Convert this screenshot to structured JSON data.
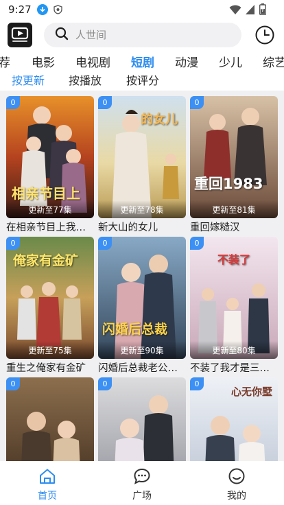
{
  "status": {
    "time": "9:27",
    "icons": [
      "download-icon",
      "shield-icon",
      "wifi-icon",
      "signal-icon",
      "battery-icon"
    ]
  },
  "header": {
    "logo_icon": "play-logo-icon",
    "search_placeholder": "人世间",
    "search_icon": "search-icon",
    "history_icon": "clock-icon"
  },
  "categories": {
    "items": [
      "荐",
      "电影",
      "电视剧",
      "短剧",
      "动漫",
      "少儿",
      "综艺"
    ],
    "active": "短剧"
  },
  "sort": {
    "items": [
      "按更新",
      "按播放",
      "按评分"
    ],
    "active": "按更新"
  },
  "accent_color": "#2c8cf0",
  "cards": [
    {
      "badge": "0",
      "episodes": "更新至77集",
      "title": "在相亲节目上我…",
      "poster_text": "相亲节目上"
    },
    {
      "badge": "0",
      "episodes": "更新至78集",
      "title": "新大山的女儿",
      "poster_text": "的女儿"
    },
    {
      "badge": "0",
      "episodes": "更新至81集",
      "title": "重回嫁糙汉",
      "poster_text": "重回1983"
    },
    {
      "badge": "0",
      "episodes": "更新至75集",
      "title": "重生之俺家有金矿",
      "poster_text": "俺家有金矿"
    },
    {
      "badge": "0",
      "episodes": "更新至90集",
      "title": "闪婚后总裁老公…",
      "poster_text": "闪婚后总裁"
    },
    {
      "badge": "0",
      "episodes": "更新至80集",
      "title": "不装了我才是三…",
      "poster_text": "不装了"
    },
    {
      "badge": "0",
      "episodes": "",
      "title": "",
      "poster_text": ""
    },
    {
      "badge": "0",
      "episodes": "",
      "title": "",
      "poster_text": ""
    },
    {
      "badge": "0",
      "episodes": "",
      "title": "",
      "poster_text": "心无你墅"
    }
  ],
  "bottom_nav": {
    "items": [
      {
        "label": "首页",
        "icon": "home-icon"
      },
      {
        "label": "广场",
        "icon": "chat-icon"
      },
      {
        "label": "我的",
        "icon": "smile-face-icon"
      }
    ],
    "active": "首页"
  }
}
